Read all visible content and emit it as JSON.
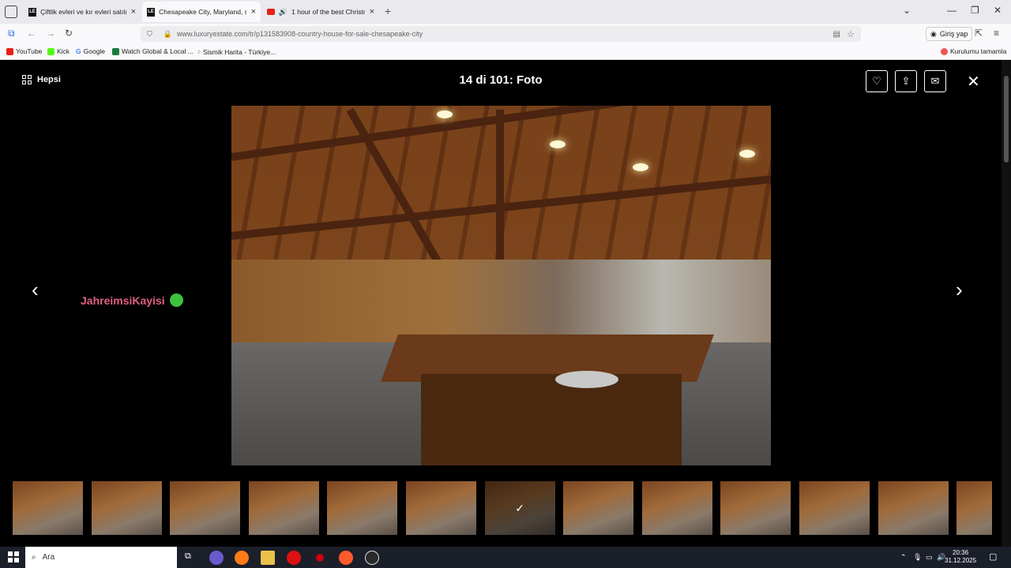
{
  "browser": {
    "tabs": [
      {
        "title": "Çiftlik evleri ve kır evleri satılık /",
        "favicon": "LE",
        "active": false
      },
      {
        "title": "Chesapeake City, Maryland, sat",
        "favicon": "LE",
        "active": true
      },
      {
        "title": "1 hour of the best Christma",
        "favicon": "youtube",
        "active": false
      }
    ],
    "url": "www.luxuryestate.com/tr/p131583908-country-house-for-sale-chesapeake-city",
    "signin_label": "Giriş yap",
    "bookmarks": [
      {
        "label": "YouTube",
        "color": "#e62117"
      },
      {
        "label": "Kick",
        "color": "#53fc18"
      },
      {
        "label": "Google",
        "color": "#4285f4"
      },
      {
        "label": "Watch Global & Local ...",
        "color": "#1a7a3a"
      },
      {
        "label": "Sismik Harita - Türkiye...",
        "color": "#cccccc"
      }
    ],
    "bookmark_right": "Kurulumu tamamla"
  },
  "gallery": {
    "all_label": "Hepsi",
    "counter": "14 di 101: Foto",
    "watermark": "JahreimsiKayisi",
    "thumbnail_count": 13,
    "selected_thumbnail": 7
  },
  "taskbar": {
    "search_placeholder": "Ara",
    "time": "20:36",
    "date": "31.12.2025"
  }
}
